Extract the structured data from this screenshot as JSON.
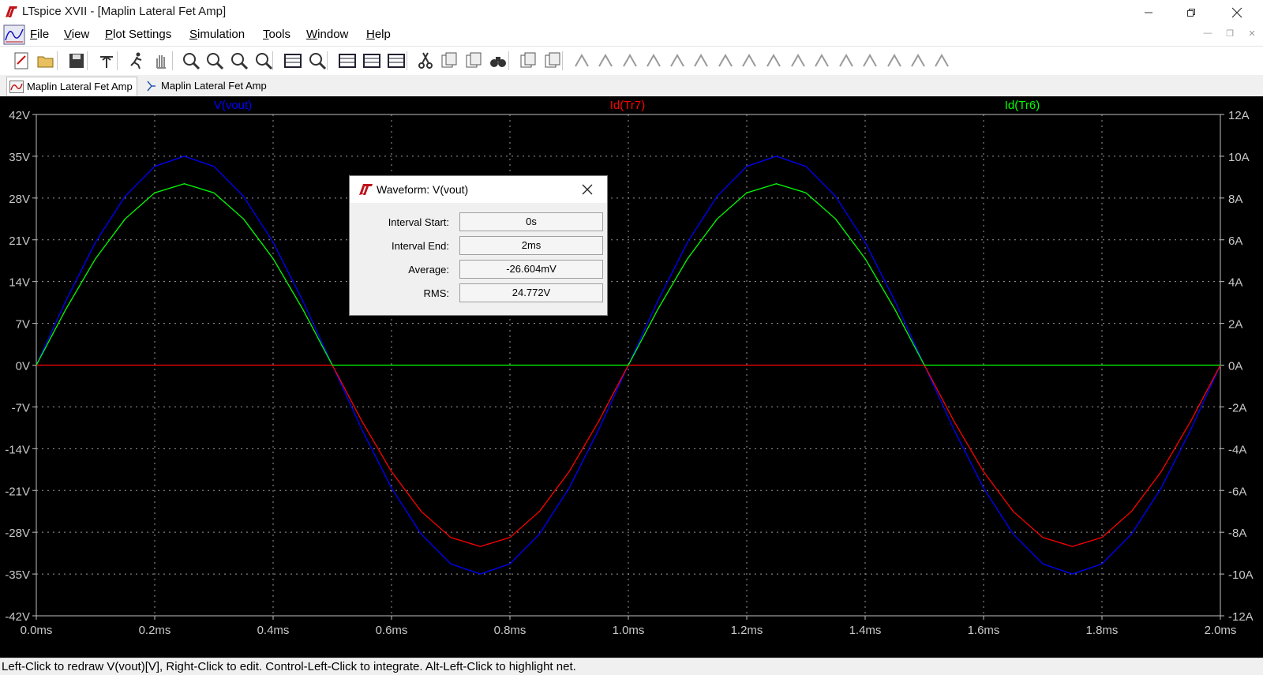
{
  "window": {
    "title": "LTspice XVII - [Maplin Lateral Fet Amp]"
  },
  "menu": [
    {
      "label": "File",
      "key": "F",
      "rest": "ile"
    },
    {
      "label": "View",
      "key": "V",
      "rest": "iew"
    },
    {
      "label": "Plot Settings",
      "key": "P",
      "rest": "lot Settings"
    },
    {
      "label": "Simulation",
      "key": "S",
      "rest": "imulation"
    },
    {
      "label": "Tools",
      "key": "T",
      "rest": "ools"
    },
    {
      "label": "Window",
      "key": "W",
      "rest": "indow"
    },
    {
      "label": "Help",
      "key": "H",
      "rest": "elp"
    }
  ],
  "toolbar": {
    "icons": [
      "new-schematic-icon",
      "open-icon",
      "save-icon",
      "control-panel-icon",
      "run-icon",
      "halt-icon",
      "zoom-area-icon",
      "zoom-back-icon",
      "zoom-out-icon",
      "zoom-fit-icon",
      "autorange-icon",
      "zoom-extents-icon",
      "tile-horizontal-icon",
      "tile-vertical-icon",
      "cascade-icon",
      "cut-icon",
      "copy-icon",
      "paste-icon",
      "find-icon",
      "print-icon",
      "print-preview-icon",
      "wire-icon",
      "ground-icon",
      "label-net-icon",
      "resistor-icon",
      "capacitor-icon",
      "inductor-icon",
      "diode-icon",
      "component-icon",
      "move-icon",
      "drag-icon",
      "undo-icon",
      "redo-icon",
      "rotate-icon",
      "mirror-icon",
      "text-icon",
      "spice-directive-icon"
    ]
  },
  "tabs": [
    {
      "label": "Maplin Lateral Fet Amp",
      "type": "waveform",
      "active": true
    },
    {
      "label": "Maplin Lateral Fet Amp",
      "type": "schematic",
      "active": false
    }
  ],
  "plot": {
    "traces": [
      {
        "name": "V(vout)",
        "color": "#0000ff"
      },
      {
        "name": "Id(Tr7)",
        "color": "#ff0000"
      },
      {
        "name": "Id(Tr6)",
        "color": "#00ff00"
      }
    ],
    "left_ticks": [
      "42V",
      "35V",
      "28V",
      "21V",
      "14V",
      "7V",
      "0V",
      "-7V",
      "-14V",
      "-21V",
      "-28V",
      "-35V",
      "-42V"
    ],
    "right_ticks": [
      "12A",
      "10A",
      "8A",
      "6A",
      "4A",
      "2A",
      "0A",
      "-2A",
      "-4A",
      "-6A",
      "-8A",
      "-10A",
      "-12A"
    ],
    "x_ticks": [
      "0.0ms",
      "0.2ms",
      "0.4ms",
      "0.6ms",
      "0.8ms",
      "1.0ms",
      "1.2ms",
      "1.4ms",
      "1.6ms",
      "1.8ms",
      "2.0ms"
    ]
  },
  "chart_data": {
    "type": "line",
    "title": "",
    "xlabel": "",
    "ylabel": "",
    "x_unit": "ms",
    "xlim": [
      0,
      2.0
    ],
    "ylim_left": [
      -42,
      42
    ],
    "ylim_right": [
      -12,
      12
    ],
    "grid": true,
    "legend": "top",
    "series": [
      {
        "name": "V(vout)",
        "axis": "left",
        "unit": "V",
        "color": "#0000ff",
        "x": [
          0,
          0.05,
          0.1,
          0.15,
          0.2,
          0.25,
          0.3,
          0.35,
          0.4,
          0.45,
          0.5,
          0.55,
          0.6,
          0.65,
          0.7,
          0.75,
          0.8,
          0.85,
          0.9,
          0.95,
          1.0,
          1.05,
          1.1,
          1.15,
          1.2,
          1.25,
          1.3,
          1.35,
          1.4,
          1.45,
          1.5,
          1.55,
          1.6,
          1.65,
          1.7,
          1.75,
          1.8,
          1.85,
          1.9,
          1.95,
          2.0
        ],
        "y": [
          0,
          10.8,
          20.6,
          28.3,
          33.3,
          35.0,
          33.3,
          28.3,
          20.6,
          10.8,
          0,
          -10.8,
          -20.6,
          -28.3,
          -33.3,
          -35.0,
          -33.3,
          -28.3,
          -20.6,
          -10.8,
          0,
          10.8,
          20.6,
          28.3,
          33.3,
          35.0,
          33.3,
          28.3,
          20.6,
          10.8,
          0,
          -10.8,
          -20.6,
          -28.3,
          -33.3,
          -35.0,
          -33.3,
          -28.3,
          -20.6,
          -10.8,
          0
        ]
      },
      {
        "name": "Id(Tr7)",
        "axis": "right",
        "unit": "A",
        "color": "#ff0000",
        "x": [
          0,
          0.05,
          0.1,
          0.15,
          0.2,
          0.25,
          0.3,
          0.35,
          0.4,
          0.45,
          0.5,
          0.55,
          0.6,
          0.65,
          0.7,
          0.75,
          0.8,
          0.85,
          0.9,
          0.95,
          1.0,
          1.05,
          1.1,
          1.15,
          1.2,
          1.25,
          1.3,
          1.35,
          1.4,
          1.45,
          1.5,
          1.55,
          1.6,
          1.65,
          1.7,
          1.75,
          1.8,
          1.85,
          1.9,
          1.95,
          2.0
        ],
        "y": [
          0,
          0,
          0,
          0,
          0,
          0,
          0,
          0,
          0,
          0,
          0,
          -2.68,
          -5.1,
          -7.0,
          -8.25,
          -8.68,
          -8.25,
          -7.0,
          -5.1,
          -2.68,
          0,
          0,
          0,
          0,
          0,
          0,
          0,
          0,
          0,
          0,
          0,
          -2.68,
          -5.1,
          -7.0,
          -8.25,
          -8.68,
          -8.25,
          -7.0,
          -5.1,
          -2.68,
          0
        ]
      },
      {
        "name": "Id(Tr6)",
        "axis": "right",
        "unit": "A",
        "color": "#00ff00",
        "x": [
          0,
          0.05,
          0.1,
          0.15,
          0.2,
          0.25,
          0.3,
          0.35,
          0.4,
          0.45,
          0.5,
          0.55,
          0.6,
          0.65,
          0.7,
          0.75,
          0.8,
          0.85,
          0.9,
          0.95,
          1.0,
          1.05,
          1.1,
          1.15,
          1.2,
          1.25,
          1.3,
          1.35,
          1.4,
          1.45,
          1.5,
          1.55,
          1.6,
          1.65,
          1.7,
          1.75,
          1.8,
          1.85,
          1.9,
          1.95,
          2.0
        ],
        "y": [
          0,
          2.68,
          5.1,
          7.0,
          8.25,
          8.68,
          8.25,
          7.0,
          5.1,
          2.68,
          0,
          0,
          0,
          0,
          0,
          0,
          0,
          0,
          0,
          0,
          0,
          2.68,
          5.1,
          7.0,
          8.25,
          8.68,
          8.25,
          7.0,
          5.1,
          2.68,
          0,
          0,
          0,
          0,
          0,
          0,
          0,
          0,
          0,
          0,
          0
        ]
      }
    ]
  },
  "dialog": {
    "title": "Waveform: V(vout)",
    "rows": [
      {
        "label": "Interval Start:",
        "value": "0s"
      },
      {
        "label": "Interval End:",
        "value": "2ms"
      },
      {
        "label": "Average:",
        "value": "-26.604mV"
      },
      {
        "label": "RMS:",
        "value": "24.772V"
      }
    ]
  },
  "status": {
    "text": "Left-Click to redraw V(vout)[V],  Right-Click to edit. Control-Left-Click to integrate. Alt-Left-Click to highlight net."
  }
}
